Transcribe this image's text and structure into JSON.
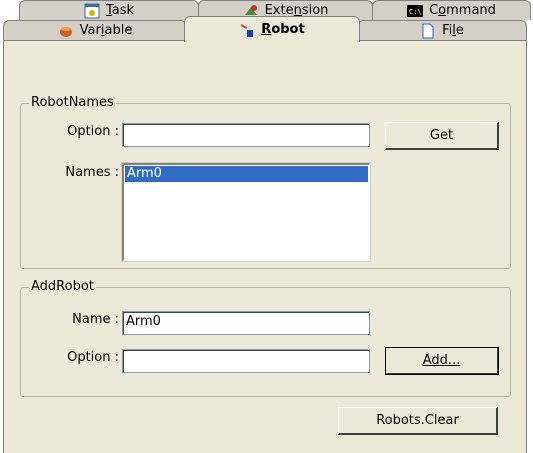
{
  "tabs_row1": [
    {
      "label": "Task",
      "icon": "task-window-icon"
    },
    {
      "label": "Extension",
      "icon": "extension-icon"
    },
    {
      "label": "Command",
      "icon": "command-prompt-icon"
    }
  ],
  "tabs_row2": [
    {
      "label": "Variable",
      "icon": "variable-icon"
    },
    {
      "label": "Robot",
      "icon": "robot-arm-icon",
      "active": true
    },
    {
      "label": "File",
      "icon": "file-icon"
    }
  ],
  "robot_names": {
    "legend": "RobotNames",
    "option_label": "Option :",
    "option_value": "",
    "get_button": "Get",
    "names_label": "Names :",
    "names": [
      "Arm0"
    ],
    "selected": "Arm0"
  },
  "add_robot": {
    "legend": "AddRobot",
    "name_label": "Name :",
    "name_value": "Arm0",
    "option_label": "Option :",
    "option_value": "",
    "add_button": "Add..."
  },
  "clear_button": "Robots.Clear",
  "colors": {
    "panel": "#ece9d8",
    "selection": "#316ac5"
  }
}
